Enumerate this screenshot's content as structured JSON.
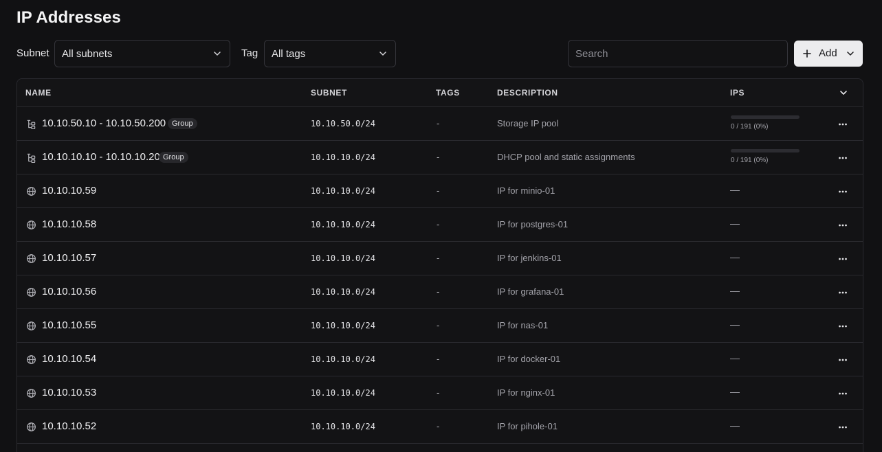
{
  "page": {
    "title": "IP Addresses"
  },
  "filters": {
    "subnet_label": "Subnet",
    "subnet_value": "All subnets",
    "tag_label": "Tag",
    "tag_value": "All tags",
    "search_placeholder": "Search",
    "add_label": "Add"
  },
  "table": {
    "columns": [
      "NAME",
      "SUBNET",
      "TAGS",
      "DESCRIPTION",
      "IPS"
    ],
    "rows": [
      {
        "type": "group",
        "icon": "tree-icon",
        "name": "10.10.50.10 - 10.10.50.200",
        "badge": "Group",
        "subnet": "10.10.50.0/24",
        "tags": "-",
        "description": "Storage IP pool",
        "ips_text": "0 / 191 (0%)",
        "ips_fraction": 0
      },
      {
        "type": "group",
        "icon": "tree-icon",
        "name": "10.10.10.10 - 10.10.10.200",
        "badge": "Group",
        "subnet": "10.10.10.0/24",
        "tags": "-",
        "description": "DHCP pool and static assignments",
        "ips_text": "0 / 191 (0%)",
        "ips_fraction": 0
      },
      {
        "type": "ip",
        "icon": "globe-icon",
        "name": "10.10.10.59",
        "subnet": "10.10.10.0/24",
        "tags": "-",
        "description": "IP for minio-01",
        "ips_text": "—"
      },
      {
        "type": "ip",
        "icon": "globe-icon",
        "name": "10.10.10.58",
        "subnet": "10.10.10.0/24",
        "tags": "-",
        "description": "IP for postgres-01",
        "ips_text": "—"
      },
      {
        "type": "ip",
        "icon": "globe-icon",
        "name": "10.10.10.57",
        "subnet": "10.10.10.0/24",
        "tags": "-",
        "description": "IP for jenkins-01",
        "ips_text": "—"
      },
      {
        "type": "ip",
        "icon": "globe-icon",
        "name": "10.10.10.56",
        "subnet": "10.10.10.0/24",
        "tags": "-",
        "description": "IP for grafana-01",
        "ips_text": "—"
      },
      {
        "type": "ip",
        "icon": "globe-icon",
        "name": "10.10.10.55",
        "subnet": "10.10.10.0/24",
        "tags": "-",
        "description": "IP for nas-01",
        "ips_text": "—"
      },
      {
        "type": "ip",
        "icon": "globe-icon",
        "name": "10.10.10.54",
        "subnet": "10.10.10.0/24",
        "tags": "-",
        "description": "IP for docker-01",
        "ips_text": "—"
      },
      {
        "type": "ip",
        "icon": "globe-icon",
        "name": "10.10.10.53",
        "subnet": "10.10.10.0/24",
        "tags": "-",
        "description": "IP for nginx-01",
        "ips_text": "—"
      },
      {
        "type": "ip",
        "icon": "globe-icon",
        "name": "10.10.10.52",
        "subnet": "10.10.10.0/24",
        "tags": "-",
        "description": "IP for pihole-01",
        "ips_text": "—"
      }
    ]
  }
}
